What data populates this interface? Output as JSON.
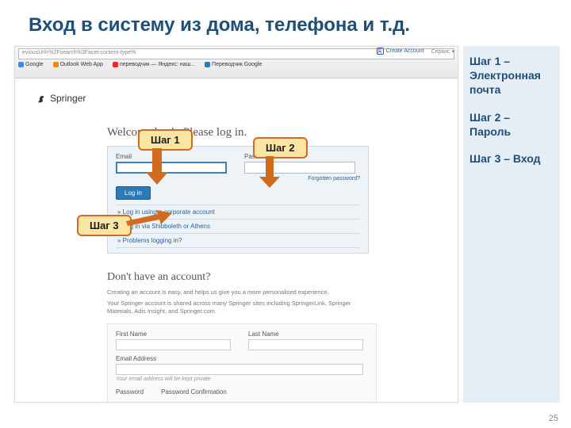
{
  "slide": {
    "title": "Вход в систему из дома, телефона и т.д.",
    "number": "25"
  },
  "sidebar": {
    "step1": "Шаг 1 – Электронная почта",
    "step2": "Шаг 2 – Пароль",
    "step3": "Шаг 3 – Вход"
  },
  "callouts": {
    "s1": "Шаг 1",
    "s2": "Шаг 2",
    "s3": "Шаг 3"
  },
  "chrome": {
    "url": "eviousUrl=%2Fsearch%3Facet-content-type%",
    "create_account": "Create Account",
    "service": "Сервис ▾",
    "bm_google": "Google",
    "bm_outlook": "Outlook Web App",
    "bm_yandex": "переводчик — Яндекс: наш...",
    "bm_gtranslate": "Переводчик Google"
  },
  "springer": {
    "brand": "Springer",
    "welcome": "Welcome back. Please log in.",
    "email_label": "Email",
    "password_label": "Password",
    "forgot": "Forgotten password?",
    "login_btn": "Log in",
    "alt1": "Log in using a corporate account",
    "alt2": "Log in via Shibboleth or Athens",
    "alt3": "Problems logging in?",
    "signup_title": "Don't have an account?",
    "signup_desc": "Creating an account is easy, and helps us give you a more personalised experience.",
    "signup_desc2": "Your Springer account is shared across many Springer sites including SpringerLink, Springer Materials, Adis Insight, and Springer.com.",
    "first_name": "First Name",
    "last_name": "Last Name",
    "email_address": "Email Address",
    "email_hint": "Your email address will be kept private",
    "password": "Password",
    "password_confirm": "Password Confirmation"
  }
}
